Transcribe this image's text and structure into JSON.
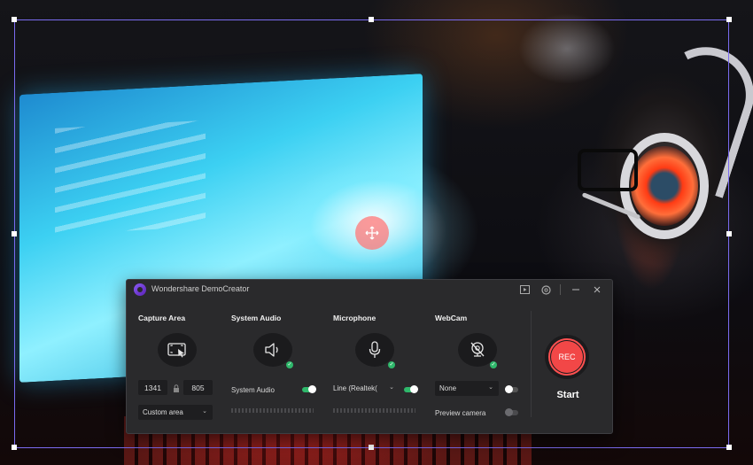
{
  "app": {
    "title": "Wondershare DemoCreator"
  },
  "capture": {
    "label": "Capture Area",
    "width": "1341",
    "height": "805",
    "mode": "Custom area"
  },
  "system_audio": {
    "label": "System Audio",
    "toggle_label": "System Audio",
    "enabled": true
  },
  "microphone": {
    "label": "Microphone",
    "device": "Line (Realtek(",
    "enabled": true
  },
  "webcam": {
    "label": "WebCam",
    "device": "None",
    "enabled": false,
    "preview_label": "Preview camera",
    "preview_enabled": false
  },
  "record": {
    "button_label": "REC",
    "start_label": "Start"
  },
  "colors": {
    "accent_red": "#f24747",
    "toggle_on": "#2fb86b",
    "selection_border": "#7a6bf0"
  },
  "icons": [
    "app-logo-icon",
    "player-icon",
    "settings-icon",
    "minimize-icon",
    "close-icon",
    "screen-capture-icon",
    "speaker-icon",
    "microphone-icon",
    "webcam-off-icon",
    "lock-icon",
    "move-icon"
  ]
}
